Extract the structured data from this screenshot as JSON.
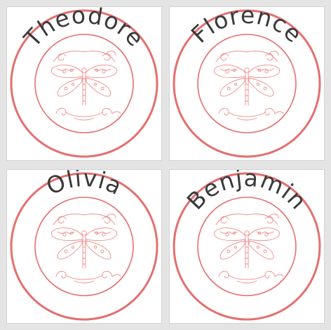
{
  "ring_color": "#e46f6f",
  "line_color": "#ee8d8d",
  "text_color": "#3a3a3a",
  "background": "#e4e4e4",
  "motif_icon": "dragonfly-icon",
  "cards": [
    {
      "name": "Theodore"
    },
    {
      "name": "Florence"
    },
    {
      "name": "Olivia"
    },
    {
      "name": "Benjamin"
    }
  ]
}
